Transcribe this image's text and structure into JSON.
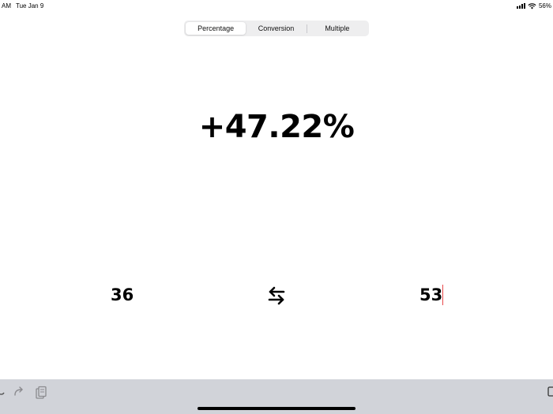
{
  "status_bar": {
    "time": "AM",
    "date": "Tue Jan 9",
    "battery": "56%"
  },
  "tabs": [
    {
      "label": "Percentage",
      "active": true
    },
    {
      "label": "Conversion",
      "active": false
    },
    {
      "label": "Multiple",
      "active": false
    }
  ],
  "result": "+47.22%",
  "inputs": {
    "from_value": "36",
    "to_value": "53"
  },
  "icons": {
    "swap": "swap-arrows-icon",
    "undo": "undo-icon",
    "redo": "redo-icon",
    "clipboard": "clipboard-icon",
    "keyboard": "keyboard-icon"
  },
  "colors": {
    "caret": "#e8474a",
    "keyboard_bar": "#d1d3d9",
    "segment_bg": "#eeeeef"
  }
}
